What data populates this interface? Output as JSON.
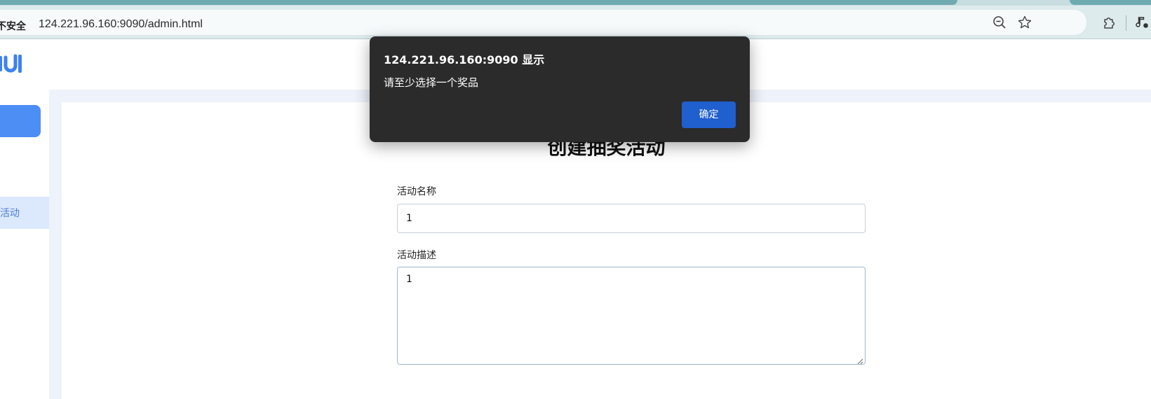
{
  "browser": {
    "security_label": "不安全",
    "url": "124.221.96.160:9090/admin.html",
    "icons": [
      "zoom-out-icon",
      "bookmark-star-icon",
      "extensions-icon",
      "media-control-icon"
    ]
  },
  "sidebar": {
    "logo_icon": "brand-logo-icon",
    "active_item_label": "活动"
  },
  "form": {
    "title": "创建抽奖活动",
    "name_label": "活动名称",
    "name_value": "1",
    "description_label": "活动描述",
    "description_value": "1"
  },
  "dialog": {
    "title": "124.221.96.160:9090 显示",
    "message": "请至少选择一个奖品",
    "ok_label": "确定"
  },
  "colors": {
    "accent": "#4d8ef5",
    "dialog_bg": "#2b2b2b",
    "dialog_button": "#1f5fce",
    "content_bg": "#eef2fa"
  }
}
